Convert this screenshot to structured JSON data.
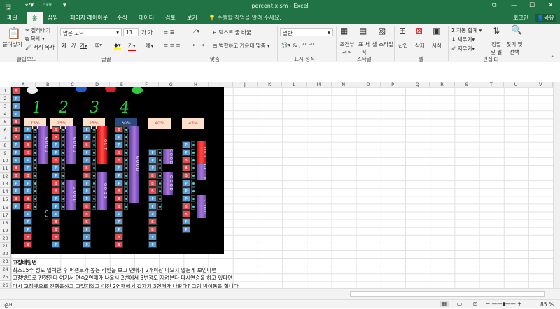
{
  "window": {
    "title": "percent.xlsm - Excel",
    "login": "로그인",
    "share": "공유"
  },
  "tabs": [
    "파일",
    "홈",
    "삽입",
    "페이지 레이아웃",
    "수식",
    "데이터",
    "검토",
    "보기"
  ],
  "active_tab": "홈",
  "tell_me": "수행할 작업을 알려 주세요.",
  "ribbon": {
    "clipboard": {
      "paste": "붙여넣기",
      "cut": "잘라내기",
      "copy": "복사",
      "format_painter": "서식 복사",
      "group": "클립보드"
    },
    "font": {
      "name": "맑은 고딕",
      "size": "11",
      "group": "글꼴"
    },
    "alignment": {
      "wrap": "텍스트 줄 바꿈",
      "merge": "병합하고 가운데 맞춤",
      "group": "맞춤"
    },
    "number": {
      "format": "일반",
      "percent": "%",
      "group": "표시 형식"
    },
    "styles": {
      "conditional": "조건부 서식",
      "table": "표 서식",
      "cell": "셀 스타일",
      "group": "스타일"
    },
    "cells": {
      "insert": "삽입",
      "delete": "삭제",
      "format": "서식",
      "group": "셀"
    },
    "editing": {
      "autosum": "자동 합계",
      "fill": "채우기",
      "clear": "지우기",
      "sort": "정렬 및 필터",
      "find": "찾기 및 선택",
      "group": "편집"
    }
  },
  "columns": [
    "A",
    "B",
    "C",
    "D",
    "E",
    "F",
    "G",
    "H",
    "I",
    "J",
    "K",
    "L",
    "M",
    "N",
    "O",
    "P",
    "Q",
    "R",
    "S",
    "T",
    "U",
    "V"
  ],
  "rows": [
    "1",
    "2",
    "3",
    "4",
    "5",
    "6",
    "7",
    "8",
    "9",
    "10",
    "11",
    "12",
    "13",
    "14",
    "15",
    "16",
    "17",
    "18",
    "19",
    "20",
    "21",
    "22",
    "23",
    "24",
    "25",
    "26"
  ],
  "picture": {
    "numbers": [
      "1",
      "2",
      "3",
      "4"
    ],
    "percents": [
      "75%",
      "25%",
      "25%",
      "30%",
      "40%",
      "45%"
    ],
    "column_a": [
      "B",
      "P",
      "P",
      "P",
      "B",
      "B",
      "B",
      "P",
      "P",
      "P",
      "B",
      "B",
      "P",
      "P",
      "B",
      "P",
      "P",
      "B"
    ],
    "good_label": "GOOD",
    "out_label": "OUT"
  },
  "notes": [
    "고정배팅변",
    "최소15수 정도 입력한 후 퍼센트가 높은 라인을 보고 연패가 2개이상 나오지 않는게 보인다면",
    "고정벳으로 진행한다 여기서 연속2연패가 나올시 2번에서 3번정도 지켜본다 다시연승을 하고 있다면",
    "다시 고정벳으로 진행을하고 그렇지않고 이전 2연패에서 갑자기 3연패가 나왔다? 그럼 방이동을 합니다"
  ],
  "status": {
    "ready": "준비",
    "zoom": "85 %"
  }
}
